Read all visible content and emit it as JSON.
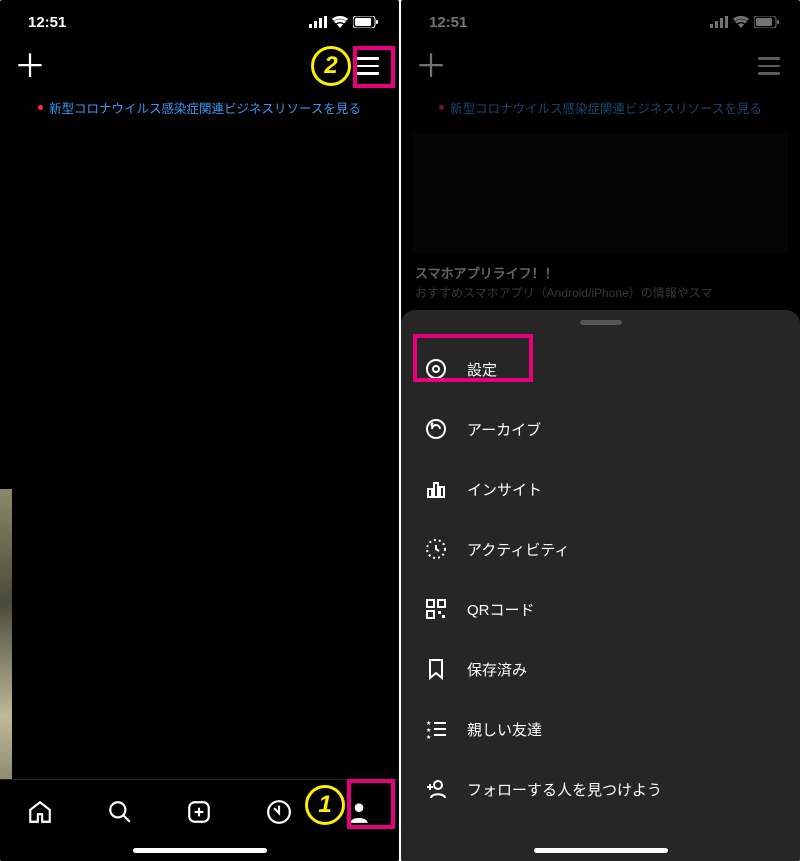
{
  "status": {
    "time": "12:51"
  },
  "banner": {
    "text": "新型コロナウイルス感染症関連ビジネスリソースを見る"
  },
  "annotations": {
    "badge1": "1",
    "badge2": "2"
  },
  "phone2": {
    "profile_name": "スマホアプリライフ！！",
    "profile_desc": "おすすめスマホアプリ（Android/iPhone）の情報やスマ"
  },
  "menu": {
    "items": [
      {
        "label": "設定"
      },
      {
        "label": "アーカイブ"
      },
      {
        "label": "インサイト"
      },
      {
        "label": "アクティビティ"
      },
      {
        "label": "QRコード"
      },
      {
        "label": "保存済み"
      },
      {
        "label": "親しい友達"
      },
      {
        "label": "フォローする人を見つけよう"
      }
    ]
  }
}
